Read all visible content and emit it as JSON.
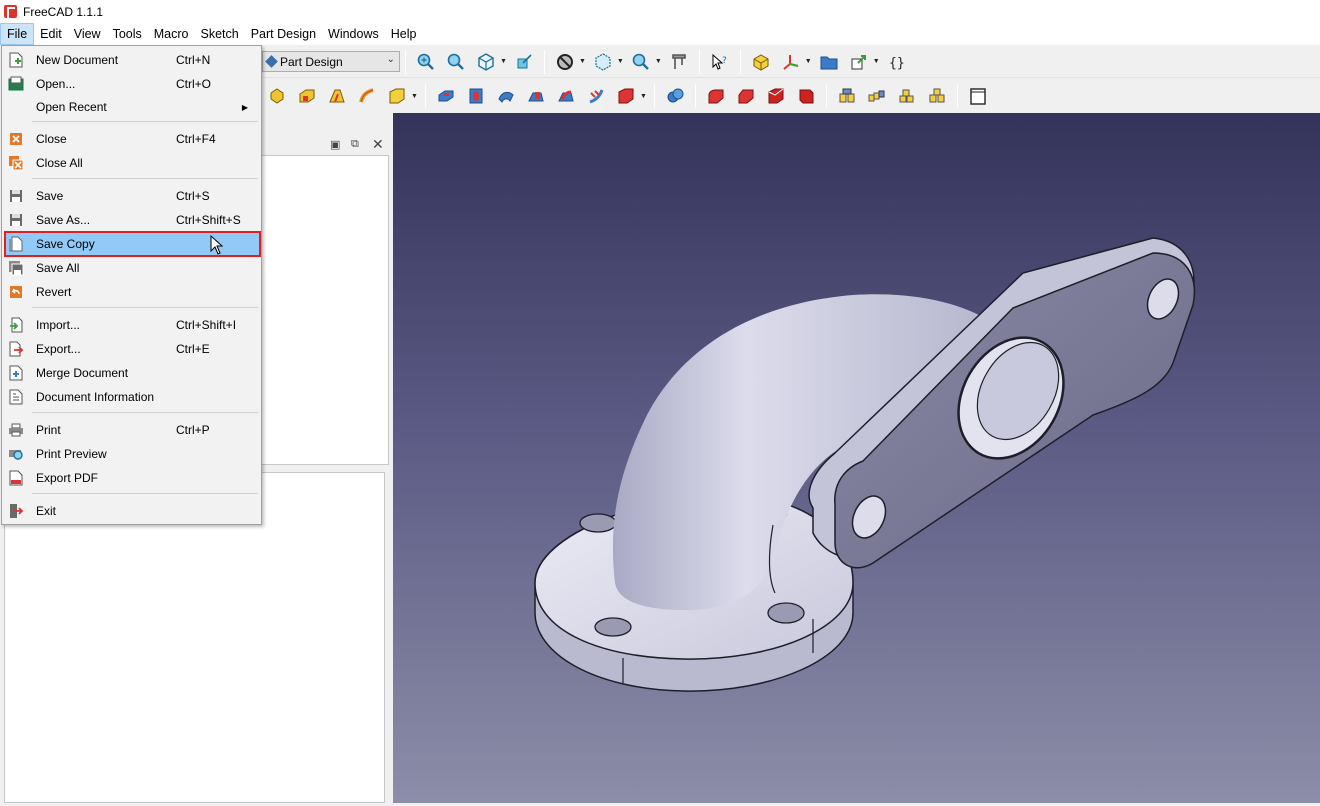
{
  "window": {
    "title": "FreeCAD 1.1.1"
  },
  "menubar": {
    "items": [
      {
        "label": "File",
        "active": true
      },
      {
        "label": "Edit"
      },
      {
        "label": "View"
      },
      {
        "label": "Tools"
      },
      {
        "label": "Macro"
      },
      {
        "label": "Sketch"
      },
      {
        "label": "Part Design"
      },
      {
        "label": "Windows"
      },
      {
        "label": "Help"
      }
    ]
  },
  "toolbar": {
    "workbench": "Part Design"
  },
  "file_menu": {
    "items": [
      {
        "label": "New Document",
        "shortcut": "Ctrl+N",
        "icon": "new-document-icon"
      },
      {
        "label": "Open...",
        "shortcut": "Ctrl+O",
        "icon": "open-icon"
      },
      {
        "label": "Open Recent",
        "shortcut": "",
        "icon": "",
        "submenu": true
      },
      {
        "label": "Close",
        "shortcut": "Ctrl+F4",
        "icon": "close-icon"
      },
      {
        "label": "Close All",
        "shortcut": "",
        "icon": "close-all-icon"
      },
      {
        "label": "Save",
        "shortcut": "Ctrl+S",
        "icon": "save-icon"
      },
      {
        "label": "Save As...",
        "shortcut": "Ctrl+Shift+S",
        "icon": "save-as-icon"
      },
      {
        "label": "Save Copy",
        "shortcut": "",
        "icon": "save-copy-icon",
        "highlighted": true
      },
      {
        "label": "Save All",
        "shortcut": "",
        "icon": "save-all-icon"
      },
      {
        "label": "Revert",
        "shortcut": "",
        "icon": "revert-icon"
      },
      {
        "label": "Import...",
        "shortcut": "Ctrl+Shift+I",
        "icon": "import-icon"
      },
      {
        "label": "Export...",
        "shortcut": "Ctrl+E",
        "icon": "export-icon"
      },
      {
        "label": "Merge Document",
        "shortcut": "",
        "icon": "merge-icon"
      },
      {
        "label": "Document Information",
        "shortcut": "",
        "icon": "document-info-icon"
      },
      {
        "label": "Print",
        "shortcut": "Ctrl+P",
        "icon": "print-icon"
      },
      {
        "label": "Print Preview",
        "shortcut": "",
        "icon": "print-preview-icon"
      },
      {
        "label": "Export PDF",
        "shortcut": "",
        "icon": "export-pdf-icon"
      },
      {
        "label": "Exit",
        "shortcut": "",
        "icon": "exit-icon"
      }
    ]
  },
  "colors": {
    "highlight": "#91c9f7",
    "highlight_border": "#e02020",
    "view_top": "#33335a",
    "view_bottom": "#8d8ea8",
    "part_fill": "#c9c9dc"
  }
}
